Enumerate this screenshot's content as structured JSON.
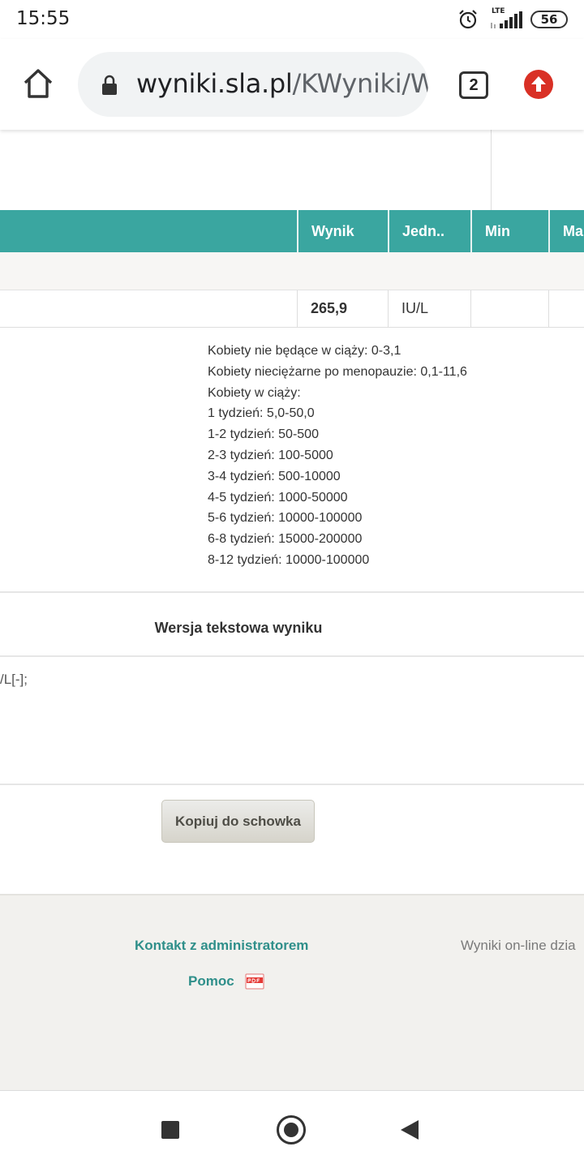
{
  "status_bar": {
    "time": "15:55",
    "network": "LTE",
    "battery": "56",
    "icons": [
      "alarm-icon",
      "signal-icon",
      "battery-icon"
    ]
  },
  "browser": {
    "url_host": "wyniki.sla.pl",
    "url_path": "/KWyniki/Wy",
    "tab_count": "2",
    "icons": [
      "home-icon",
      "lock-icon",
      "update-icon"
    ],
    "accent": "#d93025"
  },
  "table": {
    "header_color": "#3aa6a0",
    "headers": [
      "Wynik",
      "Jedn..",
      "Min",
      "Ma"
    ],
    "row": {
      "result": "265,9",
      "unit": "IU/L",
      "min": "",
      "max": ""
    }
  },
  "norms": [
    "Kobiety nie będące w ciąży: 0-3,1",
    "Kobiety nieciężarne po menopauzie: 0,1-11,6",
    "Kobiety w ciąży:",
    "1 tydzień: 5,0-50,0",
    "1-2 tydzień: 50-500",
    "2-3 tydzień: 100-5000",
    "3-4 tydzień: 500-10000",
    "4-5 tydzień: 1000-50000",
    "5-6 tydzień: 10000-100000",
    "6-8 tydzień: 15000-200000",
    "8-12 tydzień: 10000-100000"
  ],
  "text_version": {
    "title": "Wersja tekstowa wyniku",
    "content": "/L[-];"
  },
  "copy_button": "Kopiuj do schowka",
  "footer": {
    "contact": "Kontakt z administratorem",
    "help": "Pomoc",
    "right_text": "Wyniki on-line dzia",
    "link_color": "#2f8f8a"
  },
  "nav": [
    "recents-button",
    "home-button",
    "back-button"
  ]
}
